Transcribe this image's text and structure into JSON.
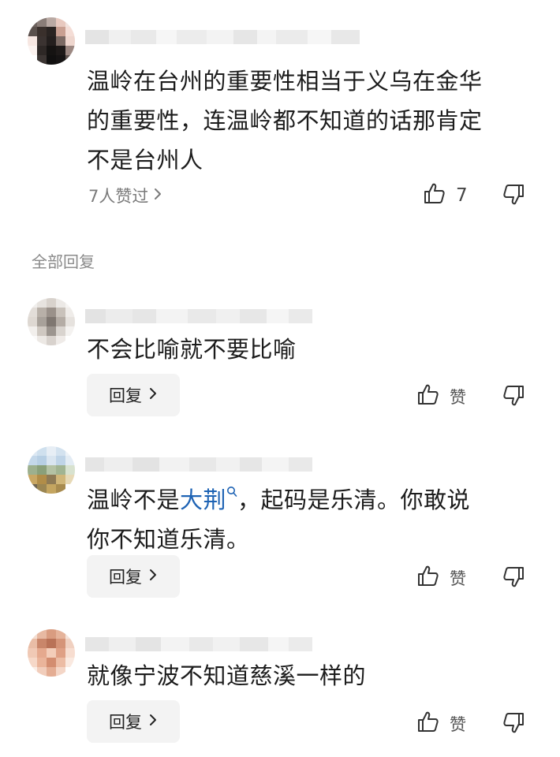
{
  "main_comment": {
    "text_lines": [
      "温岭在台州的重要性相当于义乌在金华",
      "的重要性，连温岭都不知道的话那肯定",
      "不是台州人"
    ],
    "likes_summary": "7人赞过",
    "like_count": "7"
  },
  "section_title": "全部回复",
  "replies": [
    {
      "text_lines": [
        "不会比喻就不要比喻"
      ],
      "reply_label": "回复",
      "like_label": "赞"
    },
    {
      "text_prefix": "温岭不是",
      "link_text": "大荆",
      "link_icon": "search-icon",
      "text_suffix": "，起码是乐清。你敢说",
      "text_line2": "你不知道乐清。",
      "reply_label": "回复",
      "like_label": "赞"
    },
    {
      "text_lines": [
        "就像宁波不知道慈溪一样的"
      ],
      "reply_label": "回复",
      "like_label": "赞"
    }
  ],
  "colors": {
    "link": "#1e63b4",
    "reply_bg": "#f3f3f3",
    "secondary_text": "#7a7a7a"
  }
}
